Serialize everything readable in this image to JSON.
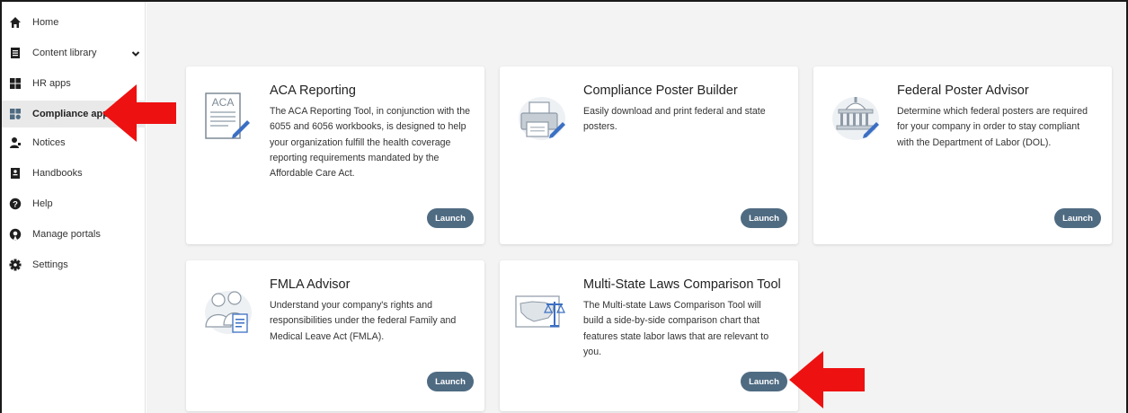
{
  "sidebar": {
    "items": [
      {
        "label": "Home",
        "icon": "home-icon"
      },
      {
        "label": "Content library",
        "icon": "document-icon"
      },
      {
        "label": "HR apps",
        "icon": "apps-grid-icon"
      },
      {
        "label": "Compliance apps",
        "icon": "compliance-grid-icon",
        "active": true
      },
      {
        "label": "Notices",
        "icon": "person-notice-icon"
      },
      {
        "label": "Handbooks",
        "icon": "handbook-icon"
      },
      {
        "label": "Help",
        "icon": "help-icon"
      },
      {
        "label": "Manage portals",
        "icon": "portal-icon"
      },
      {
        "label": "Settings",
        "icon": "gear-icon"
      }
    ]
  },
  "cards": [
    {
      "title": "ACA Reporting",
      "description": "The ACA Reporting Tool, in conjunction with the 6055 and 6056 workbooks, is designed to help your organization fulfill the health coverage reporting requirements mandated by the Affordable Care Act.",
      "icon": "aca-form-icon",
      "icon_text": "ACA",
      "button": "Launch"
    },
    {
      "title": "Compliance Poster Builder",
      "description": "Easily download and print federal and state posters.",
      "icon": "printer-icon",
      "button": "Launch"
    },
    {
      "title": "Federal Poster Advisor",
      "description": "Determine which federal posters are required for your company in order to stay compliant with the Department of Labor (DOL).",
      "icon": "capitol-building-icon",
      "button": "Launch"
    },
    {
      "title": "FMLA Advisor",
      "description": "Understand your company's rights and responsibilities under the federal Family and Medical Leave Act (FMLA).",
      "icon": "family-icon",
      "button": "Launch"
    },
    {
      "title": "Multi-State Laws Comparison Tool",
      "description": "The Multi-state Laws Comparison Tool will build a side-by-side comparison chart that features state labor laws that are relevant to you.",
      "icon": "us-map-scales-icon",
      "button": "Launch"
    }
  ],
  "colors": {
    "accent": "#4f6b82",
    "arrow": "#ee1111",
    "active_bg": "#e9e9e9",
    "main_bg": "#f3f3f3"
  }
}
